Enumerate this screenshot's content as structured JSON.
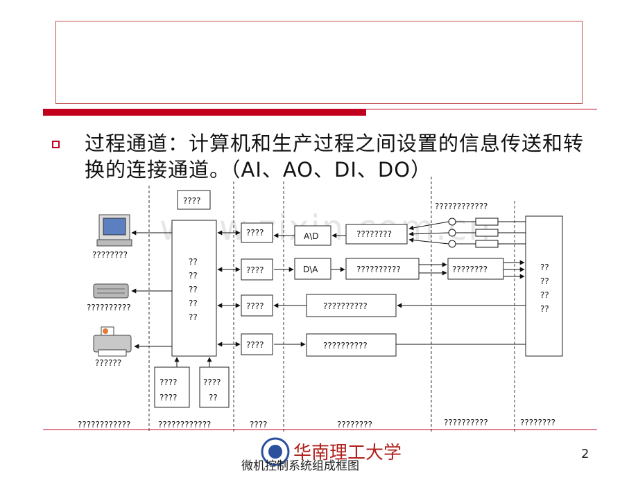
{
  "slide": {
    "bullet_text": "过程通道：计算机和生产过程之间设置的信息传送和转换的连接通道。（AI、AO、DI、DO）",
    "page_number": "2",
    "caption": "微机控制系统组成框图",
    "logo_text": "华南理工大学",
    "watermark": "www.zixin.com.cn"
  },
  "diagram": {
    "top_box": "????",
    "sensor_row_label": "????????????",
    "device_labels": {
      "computer": "????????",
      "keyboard": "??????????",
      "printer": "??????"
    },
    "host_lines": [
      "??",
      "??",
      "??",
      "??",
      "??"
    ],
    "interface_boxes": [
      "????",
      "????",
      "????",
      "????"
    ],
    "converters": {
      "ad": "A\\D",
      "da": "D\\A"
    },
    "channel_boxes": [
      "????????",
      "??????????",
      "??????????",
      "??????????"
    ],
    "output_box": "????????",
    "plant_lines": [
      "??",
      "??",
      "??",
      "??"
    ],
    "lower_boxes": [
      [
        "????",
        "????"
      ],
      [
        "????",
        "??"
      ]
    ],
    "footer_labels": [
      "????????????",
      "????????????",
      "????",
      "????????",
      "??????????",
      "????????"
    ]
  },
  "colors": {
    "accent_red": "#c0001c",
    "title_border": "#c0504d"
  }
}
